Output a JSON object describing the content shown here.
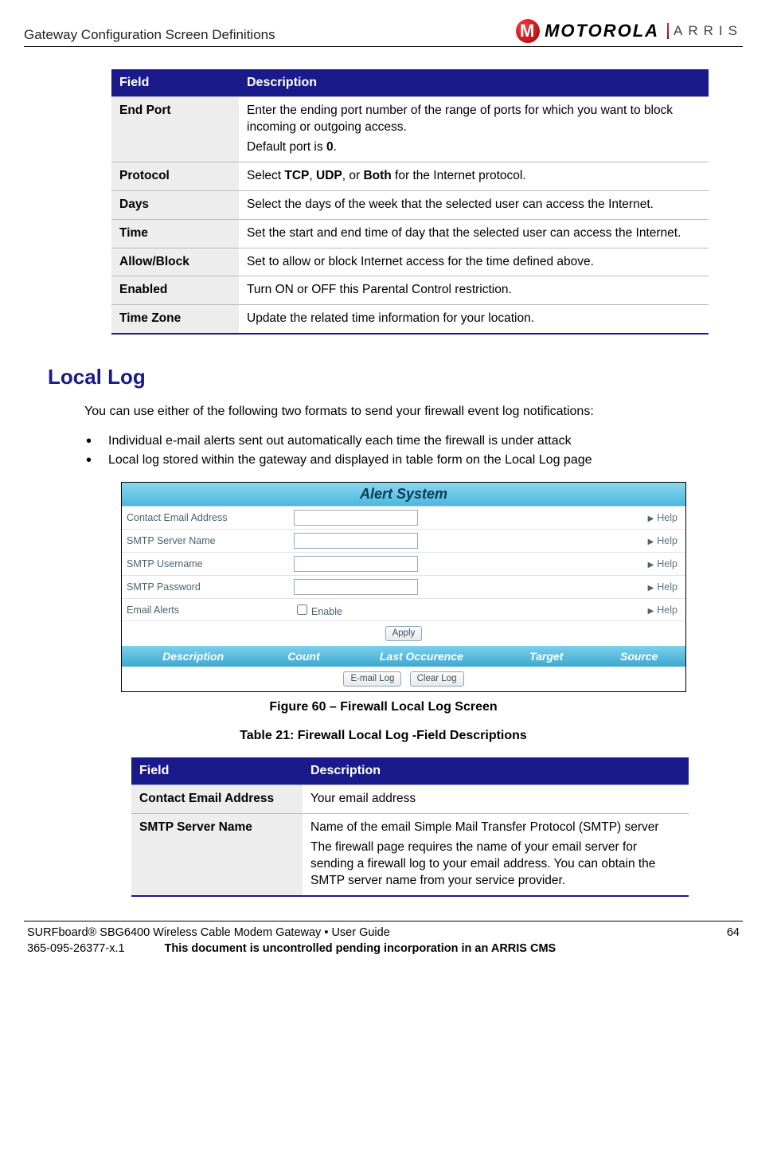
{
  "header": {
    "title": "Gateway Configuration Screen Definitions",
    "brand1": "MOTOROLA",
    "brand2": "ARRIS"
  },
  "table1": {
    "head": {
      "field": "Field",
      "desc": "Description"
    },
    "rows": [
      {
        "field": "End Port",
        "desc_line1": "Enter the ending port number of the range of ports for which you want to block incoming or outgoing access.",
        "desc_line2_pre": "Default port is ",
        "desc_line2_bold": "0",
        "desc_line2_post": "."
      },
      {
        "field": "Protocol",
        "desc_pre": "Select ",
        "desc_bold1": "TCP",
        "desc_mid1": ", ",
        "desc_bold2": "UDP",
        "desc_mid2": ", or ",
        "desc_bold3": "Both",
        "desc_post": " for the Internet protocol."
      },
      {
        "field": "Days",
        "desc": "Select the days of the week that the selected user can access the Internet."
      },
      {
        "field": "Time",
        "desc": "Set the start and end time of day that the selected user can access the Internet."
      },
      {
        "field": "Allow/Block",
        "desc": "Set to allow or block Internet access for the time defined above."
      },
      {
        "field": "Enabled",
        "desc": "Turn ON or OFF this Parental Control restriction."
      },
      {
        "field": "Time Zone",
        "desc": "Update the related time information for your location."
      }
    ]
  },
  "section": {
    "heading": "Local Log",
    "intro": "You can use either of the following two formats to send your firewall event log notifications:",
    "bullets": [
      "Individual e-mail alerts sent out automatically each time the firewall is under attack",
      "Local log stored within the gateway and displayed in table form on the Local Log page"
    ]
  },
  "ui": {
    "title": "Alert  System",
    "rows": [
      {
        "label": "Contact Email Address",
        "type": "text"
      },
      {
        "label": "SMTP Server Name",
        "type": "text"
      },
      {
        "label": "SMTP Username",
        "type": "text"
      },
      {
        "label": "SMTP Password",
        "type": "text"
      },
      {
        "label": "Email Alerts",
        "type": "checkbox",
        "cblabel": "Enable"
      }
    ],
    "help": "Help",
    "apply": "Apply",
    "loghdr": [
      "Description",
      "Count",
      "Last Occurence",
      "Target",
      "Source"
    ],
    "btn_email": "E-mail Log",
    "btn_clear": "Clear Log"
  },
  "figcaption": "Figure 60 – Firewall Local Log Screen",
  "tablecaption": "Table 21: Firewall Local Log -Field Descriptions",
  "table2": {
    "head": {
      "field": "Field",
      "desc": "Description"
    },
    "rows": [
      {
        "field": "Contact Email Address",
        "desc": "Your email address"
      },
      {
        "field": "SMTP Server Name",
        "desc1": "Name of the email Simple Mail Transfer Protocol (SMTP) server",
        "desc2": "The firewall page requires the name of your email server for sending a firewall log to your email address. You can obtain the SMTP server name from your service provider."
      }
    ]
  },
  "footer": {
    "product": "SURFboard® SBG6400 Wireless Cable Modem Gateway • User Guide",
    "page": "64",
    "doc": "365-095-26377-x.1",
    "note": "This document is uncontrolled pending incorporation in an ARRIS CMS"
  }
}
